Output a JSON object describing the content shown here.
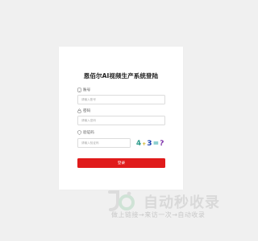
{
  "login": {
    "title": "恩佰尔AI视频生产系统登陆",
    "account_label": "账号",
    "account_placeholder": "请输入账号",
    "password_label": "密码",
    "password_placeholder": "请输入密码",
    "captcha_label": "验证码",
    "captcha_placeholder": "请输入验证码",
    "captcha_text": [
      "4",
      "+",
      "3",
      "=",
      "?"
    ],
    "submit_label": "登录",
    "accent_color": "#e01b1b"
  },
  "watermark": {
    "brand": "自动秒收录",
    "slogan": "做上链接→来访一次→自动收录"
  }
}
